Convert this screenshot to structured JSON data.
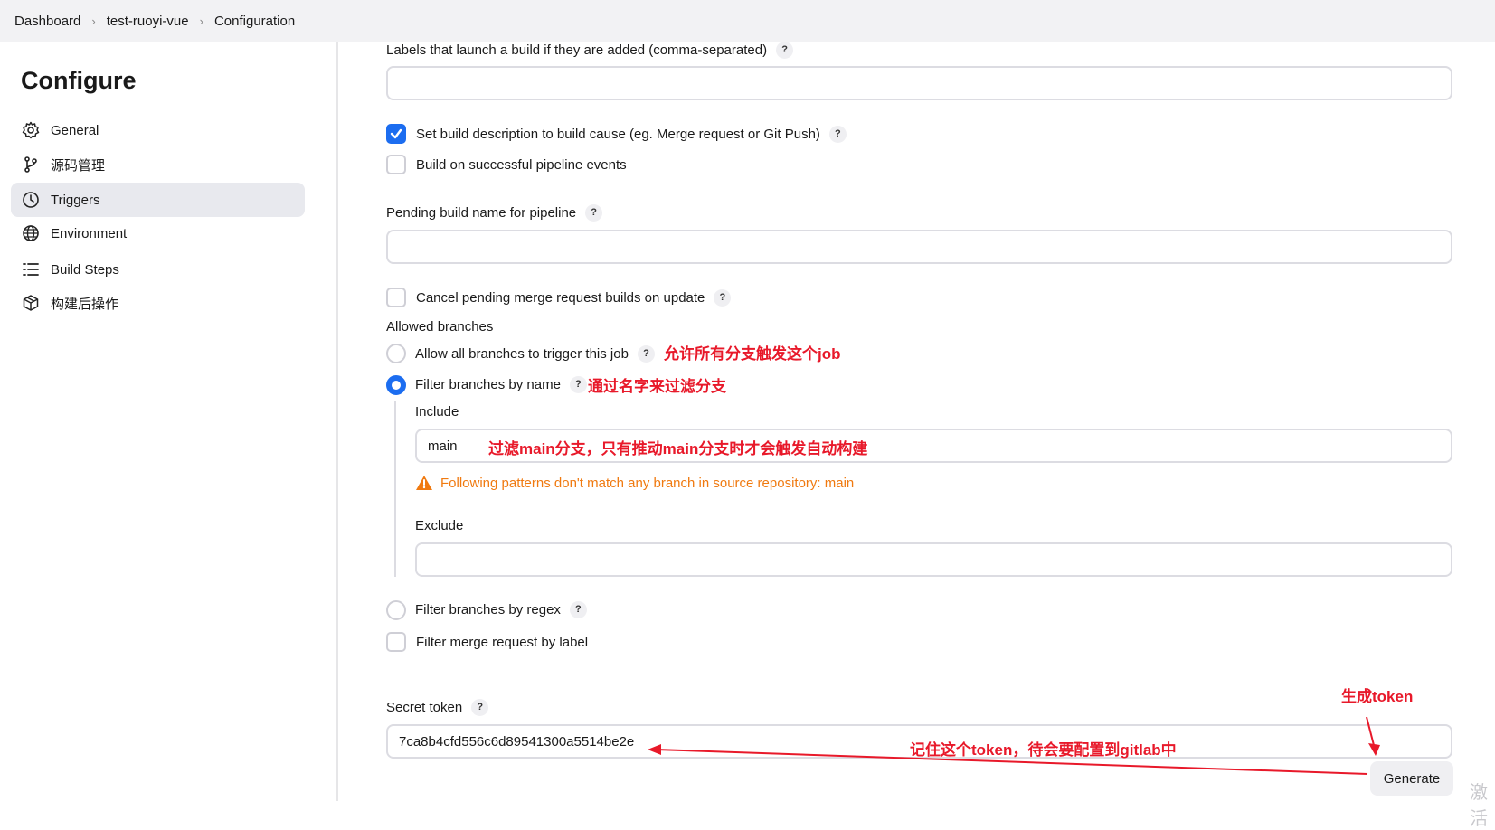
{
  "breadcrumb": {
    "items": [
      "Dashboard",
      "test-ruoyi-vue",
      "Configuration"
    ]
  },
  "sidebar": {
    "title": "Configure",
    "items": [
      {
        "label": "General",
        "icon": "gear-icon"
      },
      {
        "label": "源码管理",
        "icon": "branch-icon"
      },
      {
        "label": "Triggers",
        "icon": "clock-icon",
        "active": true
      },
      {
        "label": "Environment",
        "icon": "globe-icon"
      },
      {
        "label": "Build Steps",
        "icon": "list-icon"
      },
      {
        "label": "构建后操作",
        "icon": "package-icon"
      }
    ]
  },
  "form": {
    "labels_launch": "Labels that launch a build if they are added (comma-separated)",
    "labels_launch_value": "",
    "set_description": "Set build description to build cause (eg. Merge request or Git Push)",
    "set_description_checked": true,
    "build_pipeline_events": "Build on successful pipeline events",
    "pending_build_name": "Pending build name for pipeline",
    "pending_build_value": "",
    "cancel_pending": "Cancel pending merge request builds on update",
    "allowed_branches": "Allowed branches",
    "allow_all": "Allow all branches to trigger this job",
    "filter_by_name": "Filter branches by name",
    "include_label": "Include",
    "include_value": "main",
    "warning": "Following patterns don't match any branch in source repository: main",
    "exclude_label": "Exclude",
    "exclude_value": "",
    "filter_by_regex": "Filter branches by regex",
    "filter_mr_label": "Filter merge request by label",
    "secret_token_label": "Secret token",
    "secret_token_value": "7ca8b4cfd556c6d89541300a5514be2e",
    "generate_button": "Generate",
    "help": "?"
  },
  "annotations": {
    "allow_all_note": "允许所有分支触发这个job",
    "filter_name_note": "通过名字来过滤分支",
    "include_note": "过滤main分支，只有推动main分支时才会触发自动构建",
    "generate_note": "生成token",
    "token_note": "记住这个token，待会要配置到gitlab中",
    "color": "#e8192a"
  },
  "watermark": "激活"
}
